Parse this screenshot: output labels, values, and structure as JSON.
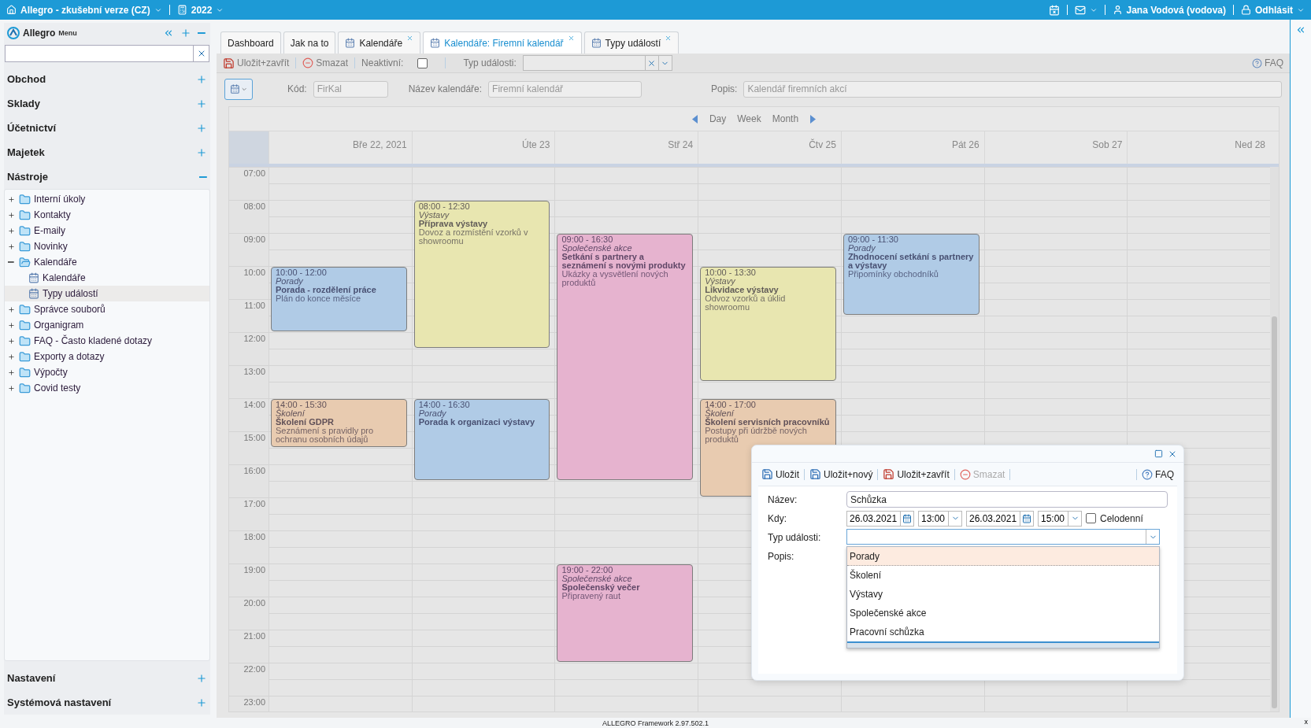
{
  "top_bar": {
    "app": "Allegro - zkušební verze (CZ)",
    "year": "2022",
    "user": "Jana Vodová (vodova)",
    "logout": "Odhlásit"
  },
  "sidebar": {
    "logo": "Allegro",
    "menu": "Menu",
    "sections_top": [
      {
        "label": "Obchod",
        "expanded": false
      },
      {
        "label": "Sklady",
        "expanded": false
      },
      {
        "label": "Účetnictví",
        "expanded": false
      },
      {
        "label": "Majetek",
        "expanded": false
      },
      {
        "label": "Nástroje",
        "expanded": true
      }
    ],
    "tree": [
      {
        "label": "Interní úkoly",
        "expanded": false,
        "selected": false
      },
      {
        "label": "Kontakty",
        "expanded": false,
        "selected": false
      },
      {
        "label": "E-maily",
        "expanded": false,
        "selected": false
      },
      {
        "label": "Novinky",
        "expanded": false,
        "selected": false
      },
      {
        "label": "Kalendáře",
        "expanded": true,
        "selected": false,
        "children": [
          {
            "label": "Kalendáře",
            "selected": false
          },
          {
            "label": "Typy událostí",
            "selected": true
          }
        ]
      },
      {
        "label": "Správce souborů",
        "expanded": false,
        "selected": false
      },
      {
        "label": "Organigram",
        "expanded": false,
        "selected": false
      },
      {
        "label": "FAQ - Často kladené dotazy",
        "expanded": false,
        "selected": false
      },
      {
        "label": "Exporty a dotazy",
        "expanded": false,
        "selected": false
      },
      {
        "label": "Výpočty",
        "expanded": false,
        "selected": false
      },
      {
        "label": "Covid testy",
        "expanded": false,
        "selected": false
      }
    ],
    "sections_bottom": [
      {
        "label": "Nastavení",
        "expanded": false
      },
      {
        "label": "Systémová nastavení",
        "expanded": false
      }
    ]
  },
  "tabs": [
    {
      "label": "Dashboard",
      "selected": false,
      "closable": false
    },
    {
      "label": "Jak na to",
      "selected": false,
      "closable": false
    },
    {
      "label": "Kalendáře",
      "selected": false,
      "closable": true
    },
    {
      "label": "Kalendáře: Firemní kalendář",
      "selected": true,
      "closable": true
    },
    {
      "label": "Typy událostí",
      "selected": false,
      "closable": true
    }
  ],
  "toolbar": {
    "items": [
      {
        "label": "Uložit+zavřít",
        "kind": "save_close"
      },
      {
        "label": "Smazat",
        "kind": "delete"
      }
    ],
    "inactive_label": "Neaktivní:",
    "inactive": false,
    "type_label": "Typ události:",
    "faq": "FAQ"
  },
  "form": {
    "code_label": "Kód:",
    "code": "FirKal",
    "name_label": "Název kalendáře:",
    "name": "Firemní kalendář",
    "desc_label": "Popis:",
    "desc": "Kalendář firemních akcí"
  },
  "calendar": {
    "views": [
      "Day",
      "Week",
      "Month"
    ],
    "hours": [
      "07:00",
      "08:00",
      "09:00",
      "10:00",
      "11:00",
      "12:00",
      "13:00",
      "14:00",
      "15:00",
      "16:00",
      "17:00",
      "18:00",
      "19:00",
      "20:00",
      "21:00",
      "22:00",
      "23:00"
    ],
    "days": [
      {
        "label": "Bře 22, 2021",
        "events": [
          {
            "time": "10:00 - 12:00",
            "type": "Porady",
            "title": "Porada - rozdělení práce",
            "description": "Plán do konce měsíce",
            "color": "#b0cbe6"
          },
          {
            "time": "14:00 - 15:30",
            "type": "Školení",
            "title": "Školení GDPR",
            "description": "Seznámení s pravidly pro ochranu osobních údajů",
            "color": "#e8cbb0"
          }
        ]
      },
      {
        "label": "Úte 23",
        "events": [
          {
            "time": "08:00 - 12:30",
            "type": "Výstavy",
            "title": "Příprava výstavy",
            "description": "Dovoz a rozmístění vzorků v showroomu",
            "color": "#e8e6b0"
          },
          {
            "time": "14:00 - 16:30",
            "type": "Porady",
            "title": "Porada k organizaci výstavy",
            "color": "#b0cbe6"
          }
        ]
      },
      {
        "label": "Stř 24",
        "events": [
          {
            "time": "09:00 - 16:30",
            "type": "Společenské akce",
            "title": "Setkání s partnery a seznámení s novými produkty",
            "description": "Ukázky a vysvětlení nových produktů",
            "color": "#e6b3cf"
          },
          {
            "time": "19:00 - 22:00",
            "type": "Společenské akce",
            "title": "Společenský večer",
            "description": "Připravený raut",
            "color": "#e6b3cf"
          }
        ]
      },
      {
        "label": "Čtv 25",
        "events": [
          {
            "time": "10:00 - 13:30",
            "type": "Výstavy",
            "title": "Likvidace výstavy",
            "description": "Odvoz vzorků a úklid showroomu",
            "color": "#e8e6b0"
          },
          {
            "time": "14:00 - 17:00",
            "type": "Školení",
            "title": "Školení servisních pracovníků",
            "description": "Postupy při údržbě nových produktů",
            "color": "#e8cbb0"
          }
        ]
      },
      {
        "label": "Pát 26",
        "events": [
          {
            "time": "09:00 - 11:30",
            "type": "Porady",
            "title": "Zhodnocení setkání s partnery a výstavy",
            "description": "Připomínky obchodníků",
            "color": "#b0cbe6"
          }
        ]
      },
      {
        "label": "Sob 27"
      },
      {
        "label": "Ned 28"
      }
    ]
  },
  "dialog": {
    "toolbar": [
      {
        "label": "Uložit",
        "kind": "save",
        "disabled": false
      },
      {
        "label": "Uložit+nový",
        "kind": "save_new",
        "disabled": false
      },
      {
        "label": "Uložit+zavřít",
        "kind": "save_close",
        "disabled": false
      },
      {
        "label": "Smazat",
        "kind": "delete",
        "disabled": true
      }
    ],
    "faq": "FAQ",
    "name_label": "Název:",
    "name": "Schůzka",
    "when_label": "Kdy:",
    "date_from": "26.03.2021",
    "time_from": "13:00",
    "date_to": "26.03.2021",
    "time_to": "15:00",
    "all_day_label": "Celodenní",
    "all_day": false,
    "type_label": "Typ události:",
    "desc_label": "Popis:",
    "dropdown": [
      {
        "label": "Porady",
        "selected": true
      },
      {
        "label": "Školení",
        "selected": false
      },
      {
        "label": "Výstavy",
        "selected": false
      },
      {
        "label": "Společenské akce",
        "selected": false
      },
      {
        "label": "Pracovní schůzka",
        "selected": false
      }
    ]
  },
  "footer": {
    "version": "ALLEGRO Framework 2.97.502.1",
    "close": "x"
  }
}
